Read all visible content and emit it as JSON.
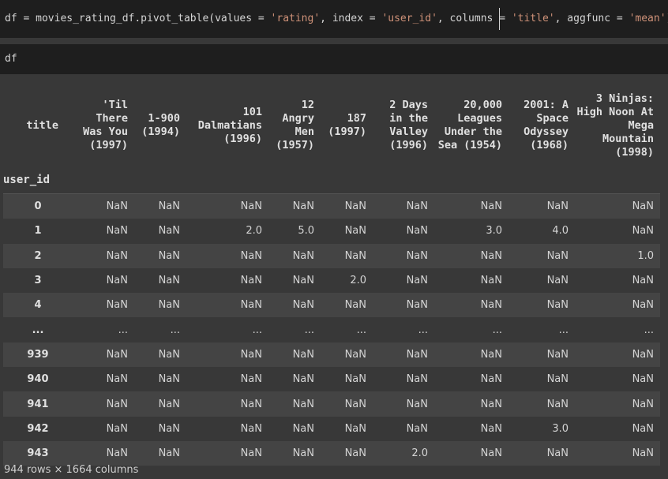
{
  "cell1": {
    "p1": "df = movies_rating_df.pivot_table(values = ",
    "s1": "'rating'",
    "p2": ", index = ",
    "s2": "'user_id'",
    "p3": ", columns ",
    "p4": " ",
    "s3": "'title'",
    "p5": ", aggfunc = ",
    "s4": "'mean'",
    "p6": ")"
  },
  "cell2": {
    "code": "df"
  },
  "table": {
    "columns_name": "title",
    "index_name": "user_id",
    "columns": [
      "'Til There Was You (1997)",
      "1-900 (1994)",
      "101 Dalmatians (1996)",
      "12 Angry Men (1957)",
      "187 (1997)",
      "2 Days in the Valley (1996)",
      "20,000 Leagues Under the Sea (1954)",
      "2001: A Space Odyssey (1968)",
      "3 Ninjas: High Noon At Mega Mountain (1998)"
    ],
    "rows": [
      {
        "idx": "0",
        "vals": [
          "NaN",
          "NaN",
          "NaN",
          "NaN",
          "NaN",
          "NaN",
          "NaN",
          "NaN",
          "NaN"
        ]
      },
      {
        "idx": "1",
        "vals": [
          "NaN",
          "NaN",
          "2.0",
          "5.0",
          "NaN",
          "NaN",
          "3.0",
          "4.0",
          "NaN"
        ]
      },
      {
        "idx": "2",
        "vals": [
          "NaN",
          "NaN",
          "NaN",
          "NaN",
          "NaN",
          "NaN",
          "NaN",
          "NaN",
          "1.0"
        ]
      },
      {
        "idx": "3",
        "vals": [
          "NaN",
          "NaN",
          "NaN",
          "NaN",
          "2.0",
          "NaN",
          "NaN",
          "NaN",
          "NaN"
        ]
      },
      {
        "idx": "4",
        "vals": [
          "NaN",
          "NaN",
          "NaN",
          "NaN",
          "NaN",
          "NaN",
          "NaN",
          "NaN",
          "NaN"
        ]
      },
      {
        "idx": "...",
        "vals": [
          "...",
          "...",
          "...",
          "...",
          "...",
          "...",
          "...",
          "...",
          "..."
        ]
      },
      {
        "idx": "939",
        "vals": [
          "NaN",
          "NaN",
          "NaN",
          "NaN",
          "NaN",
          "NaN",
          "NaN",
          "NaN",
          "NaN"
        ]
      },
      {
        "idx": "940",
        "vals": [
          "NaN",
          "NaN",
          "NaN",
          "NaN",
          "NaN",
          "NaN",
          "NaN",
          "NaN",
          "NaN"
        ]
      },
      {
        "idx": "941",
        "vals": [
          "NaN",
          "NaN",
          "NaN",
          "NaN",
          "NaN",
          "NaN",
          "NaN",
          "NaN",
          "NaN"
        ]
      },
      {
        "idx": "942",
        "vals": [
          "NaN",
          "NaN",
          "NaN",
          "NaN",
          "NaN",
          "NaN",
          "NaN",
          "3.0",
          "NaN"
        ]
      },
      {
        "idx": "943",
        "vals": [
          "NaN",
          "NaN",
          "NaN",
          "NaN",
          "NaN",
          "2.0",
          "NaN",
          "NaN",
          "NaN"
        ]
      }
    ],
    "shape": "944 rows × 1664 columns"
  }
}
